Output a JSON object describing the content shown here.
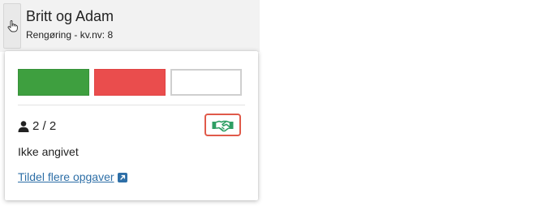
{
  "card": {
    "title": "Britt og Adam",
    "subtitle": "Rengøring - kv.nv: 8"
  },
  "icons": {
    "drag": "hand-pointer-icon",
    "person": "person-icon",
    "handshake": "handshake-icon",
    "external": "external-link-icon"
  },
  "popover": {
    "status_blocks": [
      {
        "state": "green",
        "color": "#3e9f3f"
      },
      {
        "state": "red",
        "color": "#ea4d4d"
      },
      {
        "state": "empty",
        "color": "#ffffff"
      }
    ],
    "count": "2 / 2",
    "status_text": "Ikke angivet",
    "assign_link": "Tildel flere opgaver"
  },
  "colors": {
    "link": "#2e6fa7",
    "handshake": "#2e9e63",
    "highlight_border": "#e05a4a"
  }
}
